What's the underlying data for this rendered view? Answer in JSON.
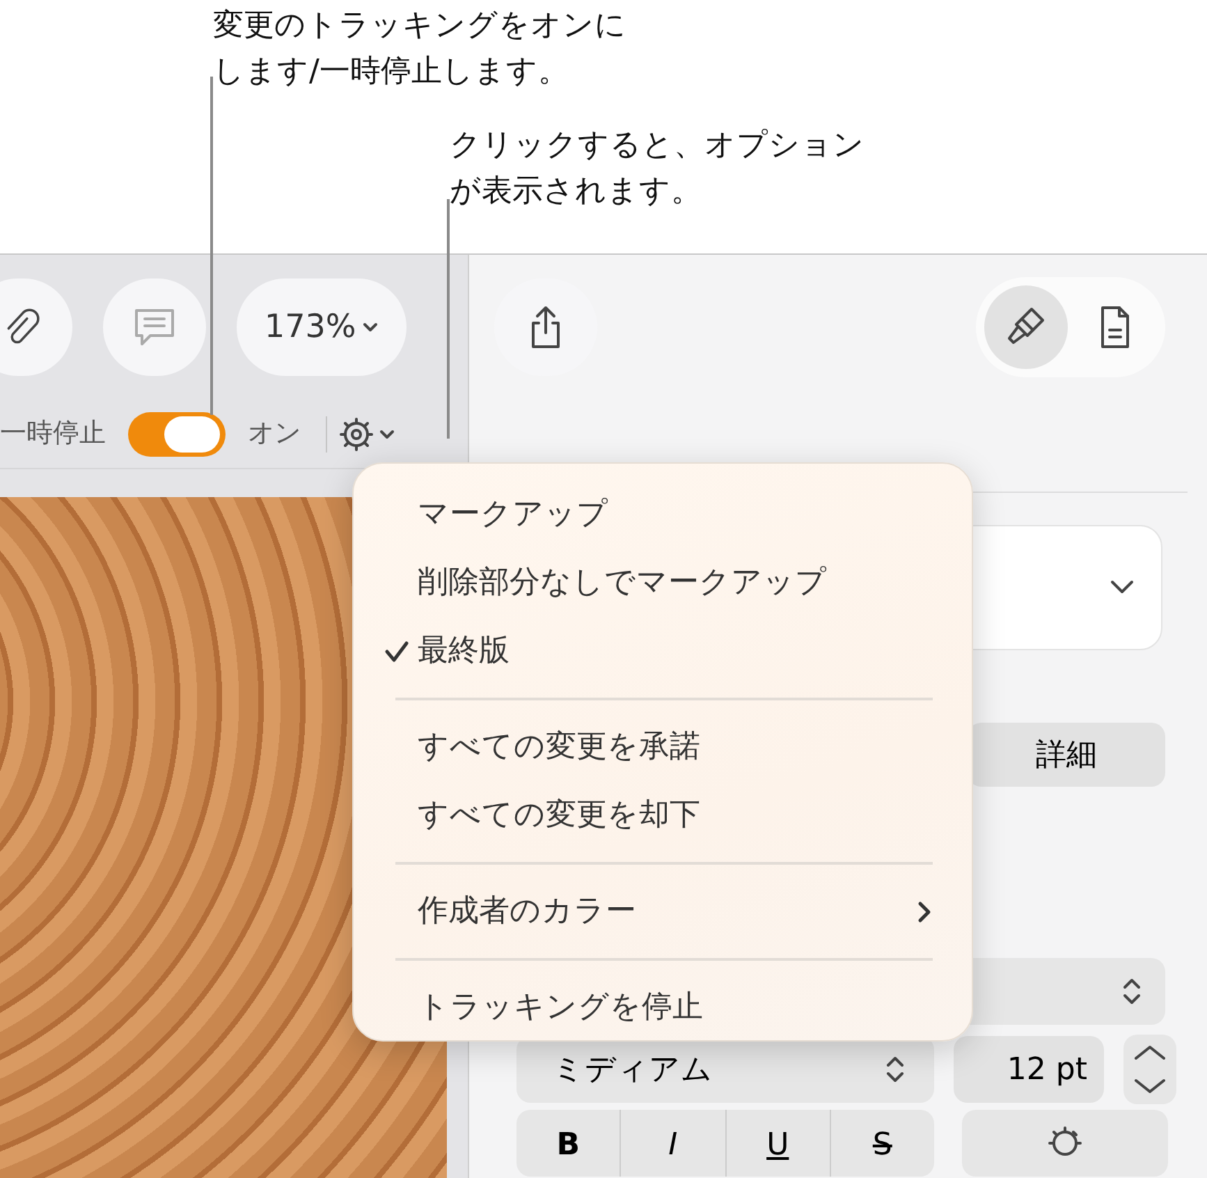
{
  "callouts": [
    {
      "lines": [
        "変更のトラッキングをオンに",
        "します/一時停止します。"
      ]
    },
    {
      "lines": [
        "クリックすると、オプション",
        "が表示されます。"
      ]
    }
  ],
  "toolbar": {
    "zoom": "173%"
  },
  "tracking_bar": {
    "pause_label": "一時停止",
    "toggle": {
      "on": true
    },
    "on_label": "オン"
  },
  "inspector": {
    "view_buttons": [
      {
        "kind": "format",
        "selected": true
      },
      {
        "kind": "document",
        "selected": false
      }
    ],
    "detail_button": "詳細",
    "font_weight": "ミディアム",
    "font_size": "12 pt",
    "style_buttons": [
      "B",
      "I",
      "U",
      "S"
    ]
  },
  "menu": {
    "items": [
      {
        "kind": "item",
        "label": "マークアップ",
        "checked": false
      },
      {
        "kind": "item",
        "label": "削除部分なしでマークアップ",
        "checked": false
      },
      {
        "kind": "item",
        "label": "最終版",
        "checked": true
      },
      {
        "kind": "separator"
      },
      {
        "kind": "item",
        "label": "すべての変更を承諾",
        "checked": false
      },
      {
        "kind": "item",
        "label": "すべての変更を却下",
        "checked": false
      },
      {
        "kind": "separator"
      },
      {
        "kind": "submenu",
        "label": "作成者のカラー",
        "checked": false
      },
      {
        "kind": "separator"
      },
      {
        "kind": "item",
        "label": "トラッキングを停止",
        "checked": false
      }
    ]
  }
}
